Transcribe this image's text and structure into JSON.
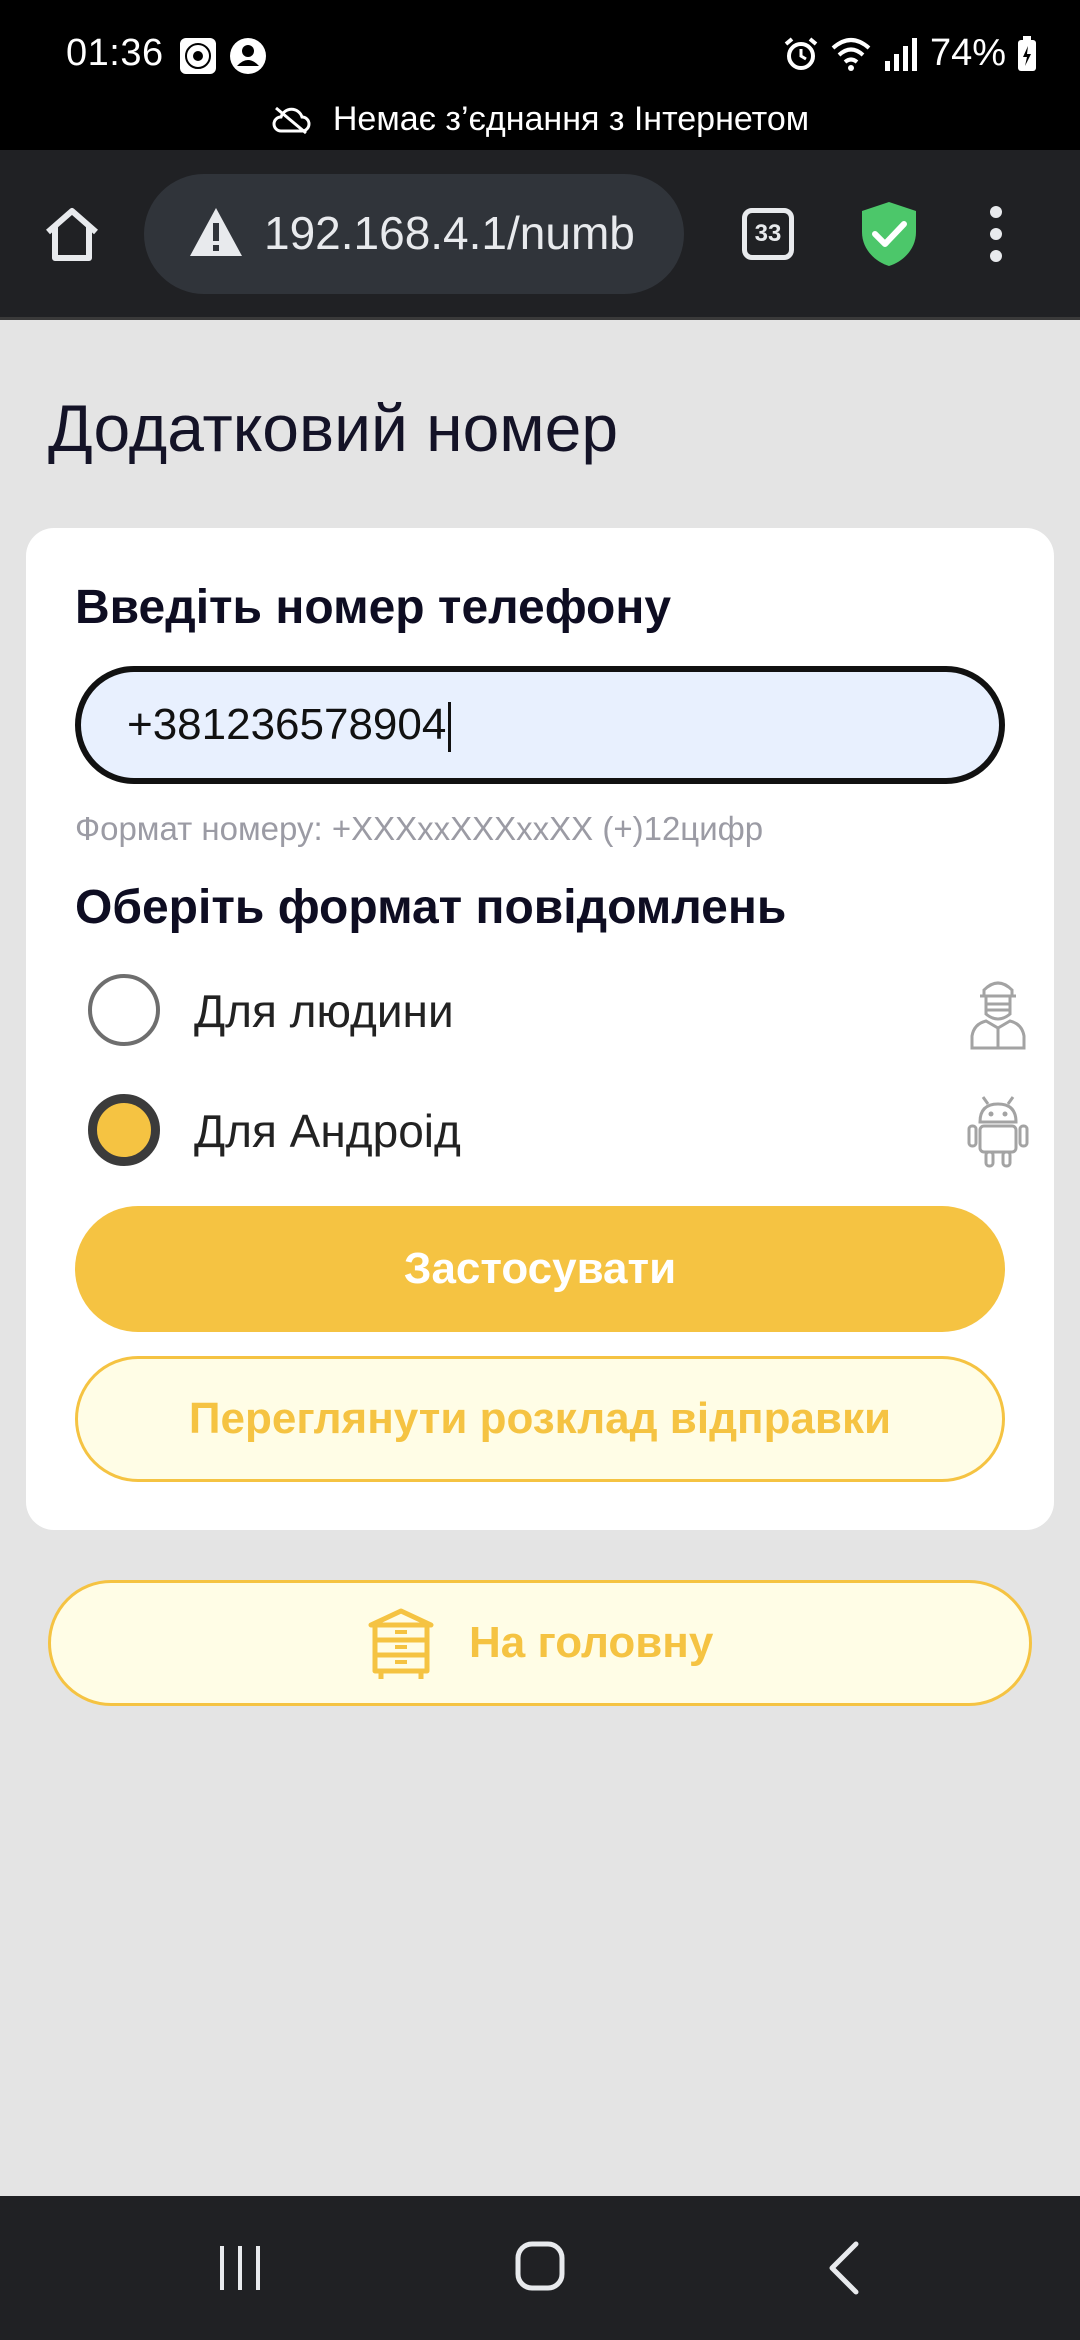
{
  "status_bar": {
    "time": "01:36",
    "battery": "74%",
    "offline_notice": "Немає з’єднання з Інтернетом",
    "icons": [
      "gallery-icon",
      "account-icon",
      "alarm-icon",
      "wifi-icon",
      "signal-icon",
      "battery-icon",
      "cloud-off-icon"
    ]
  },
  "browser": {
    "url": "192.168.4.1/numb",
    "tab_count": "33",
    "icons": [
      "home-icon",
      "warning-icon",
      "shield-check-icon",
      "more-vert-icon"
    ],
    "shield_color": "#4cc76a"
  },
  "page": {
    "title": "Додатковий номер",
    "phone_label": "Введіть номер телефону",
    "phone_value": "+381236578904",
    "phone_hint": "Формат номеру: +XXXxxXXXxxXX (+)12цифр",
    "format_label": "Оберіть формат повідомлень",
    "options": [
      {
        "label": "Для людини",
        "selected": false,
        "icon": "beekeeper-icon"
      },
      {
        "label": "Для Андроід",
        "selected": true,
        "icon": "android-icon"
      }
    ],
    "apply_button": "Застосувати",
    "schedule_button": "Переглянути розклад відправки",
    "home_button": "На головну",
    "home_icon": "beehive-icon"
  },
  "colors": {
    "accent": "#f5c342",
    "accent_light": "#fffde6",
    "input_bg": "#e8f0fe",
    "page_bg": "#e4e4e4"
  },
  "nav_bar": {
    "icons": [
      "recent-apps-icon",
      "home-nav-icon",
      "back-icon"
    ]
  }
}
